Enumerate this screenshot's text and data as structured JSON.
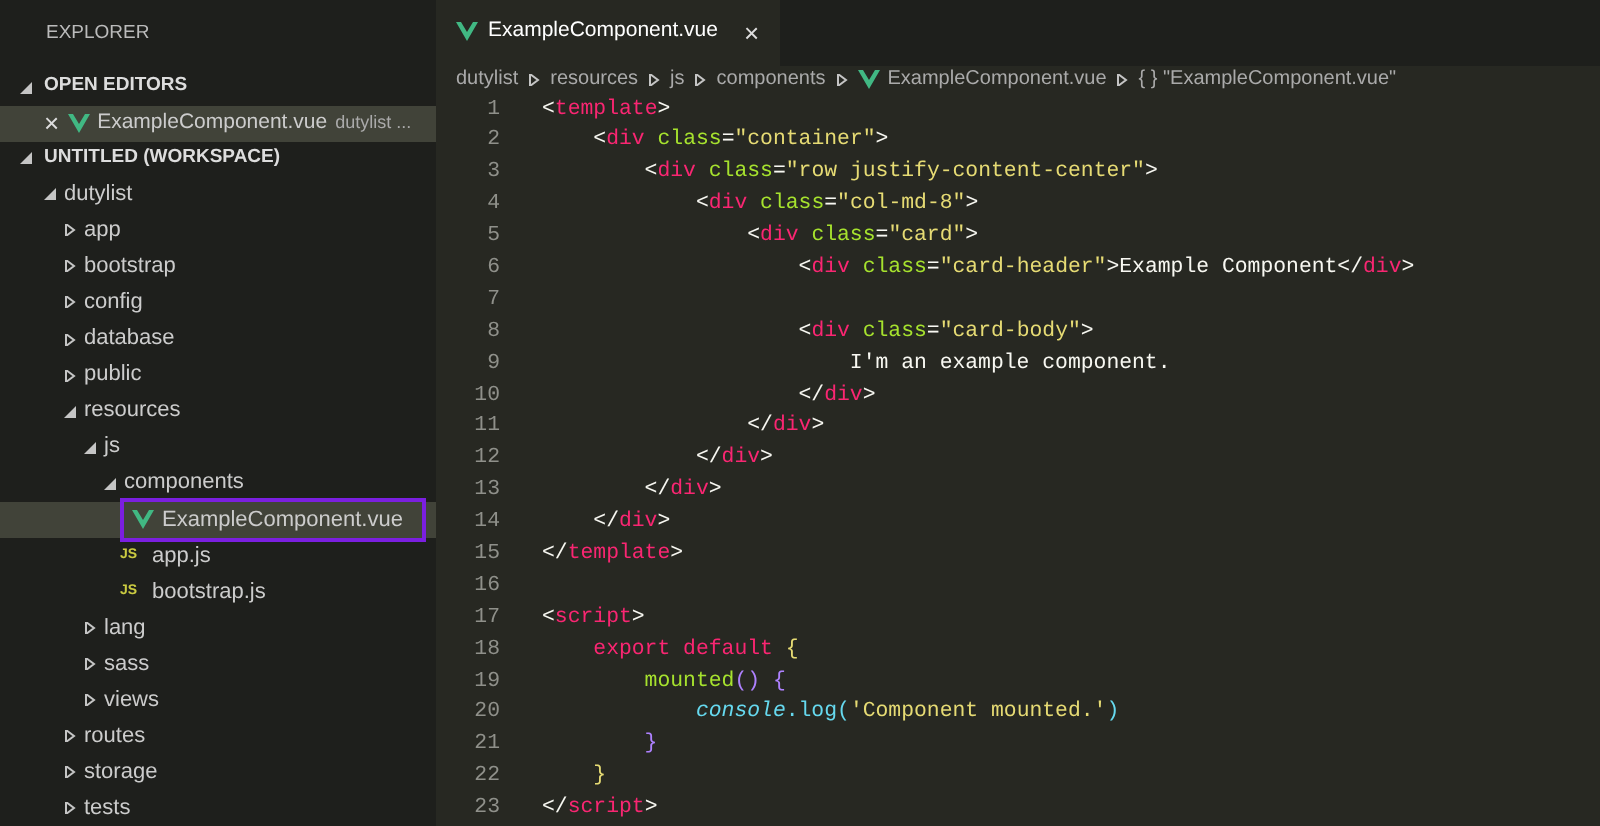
{
  "sidebar": {
    "title": "EXPLORER",
    "open_editors": {
      "label": "OPEN EDITORS",
      "expanded": true,
      "items": [
        {
          "name": "ExampleComponent.vue",
          "description": "dutylist ...",
          "kind": "vue",
          "close": "×"
        }
      ]
    },
    "workspace": {
      "label": "UNTITLED (WORKSPACE)",
      "expanded": true,
      "tree": [
        {
          "name": "dutylist",
          "kind": "folder",
          "expanded": true,
          "selected": false,
          "children": [
            {
              "name": "app",
              "kind": "folder",
              "expanded": false,
              "selected": false
            },
            {
              "name": "bootstrap",
              "kind": "folder",
              "expanded": false,
              "selected": false
            },
            {
              "name": "config",
              "kind": "folder",
              "expanded": false,
              "selected": false
            },
            {
              "name": "database",
              "kind": "folder",
              "expanded": false,
              "selected": false
            },
            {
              "name": "public",
              "kind": "folder",
              "expanded": false,
              "selected": false
            },
            {
              "name": "resources",
              "kind": "folder",
              "expanded": true,
              "selected": false,
              "children": [
                {
                  "name": "js",
                  "kind": "folder",
                  "expanded": true,
                  "selected": false,
                  "children": [
                    {
                      "name": "components",
                      "kind": "folder",
                      "expanded": true,
                      "selected": false,
                      "children": [
                        {
                          "name": "ExampleComponent.vue",
                          "kind": "vue",
                          "selected": true
                        }
                      ]
                    },
                    {
                      "name": "app.js",
                      "kind": "js",
                      "badge": "JS",
                      "selected": false
                    },
                    {
                      "name": "bootstrap.js",
                      "kind": "js",
                      "badge": "JS",
                      "selected": false
                    }
                  ]
                },
                {
                  "name": "lang",
                  "kind": "folder",
                  "expanded": false,
                  "selected": false
                },
                {
                  "name": "sass",
                  "kind": "folder",
                  "expanded": false,
                  "selected": false
                },
                {
                  "name": "views",
                  "kind": "folder",
                  "expanded": false,
                  "selected": false
                }
              ]
            },
            {
              "name": "routes",
              "kind": "folder",
              "expanded": false,
              "selected": false
            },
            {
              "name": "storage",
              "kind": "folder",
              "expanded": false,
              "selected": false
            },
            {
              "name": "tests",
              "kind": "folder",
              "expanded": false,
              "selected": false
            }
          ]
        }
      ]
    }
  },
  "tabs": [
    {
      "label": "ExampleComponent.vue",
      "kind": "vue",
      "selected": true,
      "close": "×"
    }
  ],
  "breadcrumb": [
    {
      "label": "dutylist",
      "kind": "text"
    },
    {
      "label": "resources",
      "kind": "text"
    },
    {
      "label": "js",
      "kind": "text"
    },
    {
      "label": "components",
      "kind": "text"
    },
    {
      "label": "ExampleComponent.vue",
      "kind": "vue"
    },
    {
      "label": "{ } \"ExampleComponent.vue\"",
      "kind": "text"
    }
  ],
  "editor": {
    "lines": [
      {
        "number": "1",
        "tokens": [
          {
            "text": "<",
            "kind": "plain"
          },
          {
            "text": "template",
            "kind": "tag"
          },
          {
            "text": ">",
            "kind": "plain"
          }
        ]
      },
      {
        "number": "2",
        "tokens": [
          {
            "text": "    <",
            "kind": "plain"
          },
          {
            "text": "div",
            "kind": "tag"
          },
          {
            "text": " class",
            "kind": "attr"
          },
          {
            "text": "=",
            "kind": "plain"
          },
          {
            "text": "\"container\"",
            "kind": "string"
          },
          {
            "text": ">",
            "kind": "plain"
          }
        ]
      },
      {
        "number": "3",
        "tokens": [
          {
            "text": "        <",
            "kind": "plain"
          },
          {
            "text": "div",
            "kind": "tag"
          },
          {
            "text": " class",
            "kind": "attr"
          },
          {
            "text": "=",
            "kind": "plain"
          },
          {
            "text": "\"row justify-content-center\"",
            "kind": "string"
          },
          {
            "text": ">",
            "kind": "plain"
          }
        ]
      },
      {
        "number": "4",
        "tokens": [
          {
            "text": "            <",
            "kind": "plain"
          },
          {
            "text": "div",
            "kind": "tag"
          },
          {
            "text": " class",
            "kind": "attr"
          },
          {
            "text": "=",
            "kind": "plain"
          },
          {
            "text": "\"col-md-8\"",
            "kind": "string"
          },
          {
            "text": ">",
            "kind": "plain"
          }
        ]
      },
      {
        "number": "5",
        "tokens": [
          {
            "text": "                <",
            "kind": "plain"
          },
          {
            "text": "div",
            "kind": "tag"
          },
          {
            "text": " class",
            "kind": "attr"
          },
          {
            "text": "=",
            "kind": "plain"
          },
          {
            "text": "\"card\"",
            "kind": "string"
          },
          {
            "text": ">",
            "kind": "plain"
          }
        ]
      },
      {
        "number": "6",
        "tokens": [
          {
            "text": "                    <",
            "kind": "plain"
          },
          {
            "text": "div",
            "kind": "tag"
          },
          {
            "text": " class",
            "kind": "attr"
          },
          {
            "text": "=",
            "kind": "plain"
          },
          {
            "text": "\"card-header\"",
            "kind": "string"
          },
          {
            "text": ">Example Component</",
            "kind": "plain"
          },
          {
            "text": "div",
            "kind": "tag"
          },
          {
            "text": ">",
            "kind": "plain"
          }
        ]
      },
      {
        "number": "7"
      },
      {
        "number": "8",
        "tokens": [
          {
            "text": "                    <",
            "kind": "plain"
          },
          {
            "text": "div",
            "kind": "tag"
          },
          {
            "text": " class",
            "kind": "attr"
          },
          {
            "text": "=",
            "kind": "plain"
          },
          {
            "text": "\"card-body\"",
            "kind": "string"
          },
          {
            "text": ">",
            "kind": "plain"
          }
        ]
      },
      {
        "number": "9",
        "tokens": [
          {
            "text": "                        I'm an example component.",
            "kind": "plain"
          }
        ]
      },
      {
        "number": "10",
        "tokens": [
          {
            "text": "                    </",
            "kind": "plain"
          },
          {
            "text": "div",
            "kind": "tag"
          },
          {
            "text": ">",
            "kind": "plain"
          }
        ]
      },
      {
        "number": "11",
        "tokens": [
          {
            "text": "                </",
            "kind": "plain"
          },
          {
            "text": "div",
            "kind": "tag"
          },
          {
            "text": ">",
            "kind": "plain"
          }
        ]
      },
      {
        "number": "12",
        "tokens": [
          {
            "text": "            </",
            "kind": "plain"
          },
          {
            "text": "div",
            "kind": "tag"
          },
          {
            "text": ">",
            "kind": "plain"
          }
        ]
      },
      {
        "number": "13",
        "tokens": [
          {
            "text": "        </",
            "kind": "plain"
          },
          {
            "text": "div",
            "kind": "tag"
          },
          {
            "text": ">",
            "kind": "plain"
          }
        ]
      },
      {
        "number": "14",
        "tokens": [
          {
            "text": "    </",
            "kind": "plain"
          },
          {
            "text": "div",
            "kind": "tag"
          },
          {
            "text": ">",
            "kind": "plain"
          }
        ]
      },
      {
        "number": "15",
        "tokens": [
          {
            "text": "</",
            "kind": "plain"
          },
          {
            "text": "template",
            "kind": "tag"
          },
          {
            "text": ">",
            "kind": "plain"
          }
        ]
      },
      {
        "number": "16"
      },
      {
        "number": "17",
        "tokens": [
          {
            "text": "<",
            "kind": "plain"
          },
          {
            "text": "script",
            "kind": "tag"
          },
          {
            "text": ">",
            "kind": "plain"
          }
        ]
      },
      {
        "number": "18",
        "tokens": [
          {
            "text": "    export default",
            "kind": "keyword"
          },
          {
            "text": " {",
            "kind": "brace"
          }
        ]
      },
      {
        "number": "19",
        "tokens": [
          {
            "text": "        mounted",
            "kind": "function"
          },
          {
            "text": "() {",
            "kind": "paren"
          }
        ]
      },
      {
        "number": "20",
        "tokens": [
          {
            "text": "            console",
            "kind": "object"
          },
          {
            "text": ".log(",
            "kind": "call"
          },
          {
            "text": "'Component mounted.'",
            "kind": "string"
          },
          {
            "text": ")",
            "kind": "call"
          }
        ]
      },
      {
        "number": "21",
        "tokens": [
          {
            "text": "        }",
            "kind": "paren"
          }
        ]
      },
      {
        "number": "22",
        "tokens": [
          {
            "text": "    }",
            "kind": "brace"
          }
        ]
      },
      {
        "number": "23",
        "tokens": [
          {
            "text": "</",
            "kind": "plain"
          },
          {
            "text": "script",
            "kind": "tag"
          },
          {
            "text": ">",
            "kind": "plain"
          }
        ]
      }
    ]
  }
}
